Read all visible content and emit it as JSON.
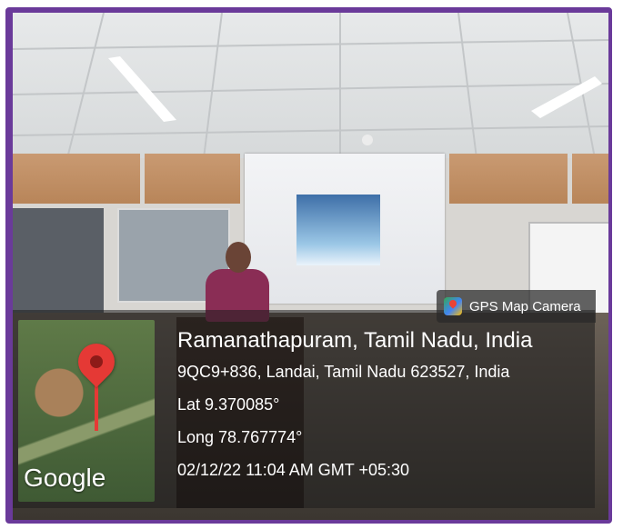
{
  "overlay": {
    "badge_label": "GPS Map Camera",
    "location_title": "Ramanathapuram, Tamil Nadu, India",
    "address": "9QC9+836, Landai, Tamil Nadu 623527, India",
    "latitude": "Lat 9.370085°",
    "longitude": "Long 78.767774°",
    "timestamp": "02/12/22 11:04 AM GMT +05:30"
  },
  "map": {
    "provider_mark": "Google",
    "pin_icon": "map-pin-icon"
  },
  "colors": {
    "frame": "#6a3a9a",
    "pin": "#e53935"
  }
}
